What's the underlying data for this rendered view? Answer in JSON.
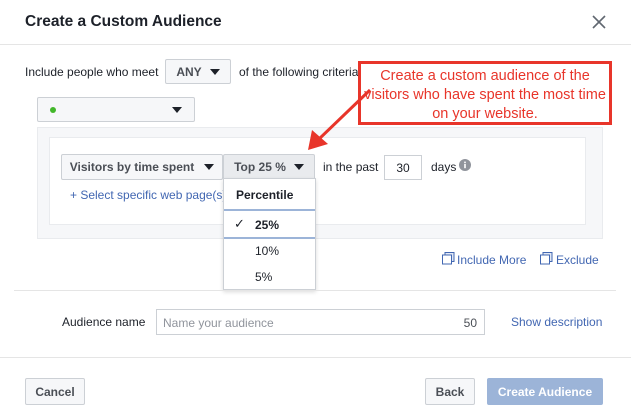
{
  "dialog": {
    "title": "Create a Custom Audience"
  },
  "criteria": {
    "prefix": "Include people who meet",
    "match_value": "ANY",
    "suffix": "of the following criteria:"
  },
  "rule": {
    "source_status_color": "#42b72a",
    "event_value": "Visitors by time spent",
    "percentile_value": "Top 25 %",
    "in_the_past_label": "in the past",
    "days_value": "30",
    "days_label": "days",
    "specific_pages_link": "+ Select specific web page(s)"
  },
  "percentile_dropdown": {
    "header": "Percentile",
    "options": [
      {
        "label": "25%",
        "selected": true
      },
      {
        "label": "10%",
        "selected": false
      },
      {
        "label": "5%",
        "selected": false
      }
    ]
  },
  "actions": {
    "include_more": "Include More",
    "exclude": "Exclude"
  },
  "audience_name": {
    "label": "Audience name",
    "placeholder": "Name your audience",
    "char_limit": "50",
    "show_description": "Show description"
  },
  "footer": {
    "cancel": "Cancel",
    "back": "Back",
    "create": "Create Audience"
  },
  "annotation": {
    "text": "Create a custom audience of the visitors who have spent the most time on your website."
  },
  "colors": {
    "accent_link": "#4267b2",
    "annotation_red": "#e8352a",
    "create_button_disabled": "#9cb4d8"
  }
}
